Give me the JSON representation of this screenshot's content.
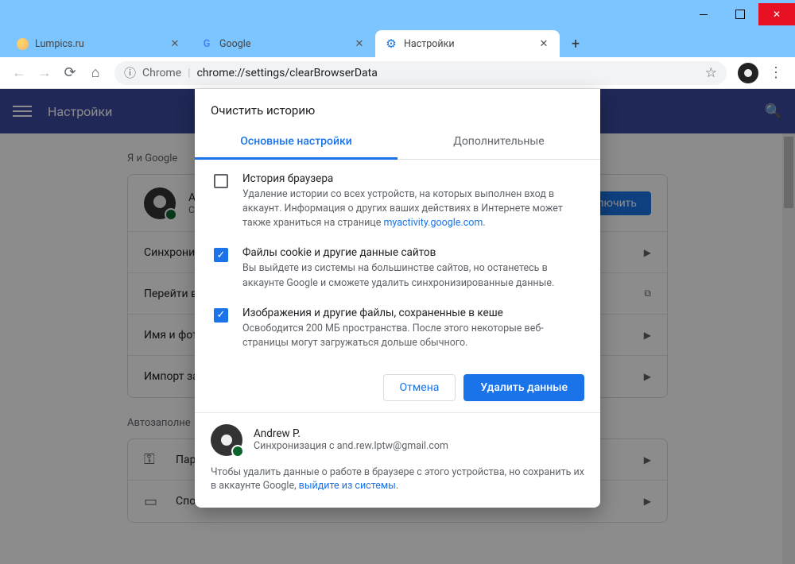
{
  "window": {
    "tabs": [
      {
        "title": "Lumpics.ru"
      },
      {
        "title": "Google"
      },
      {
        "title": "Настройки"
      }
    ]
  },
  "toolbar": {
    "chrome_label": "Chrome",
    "url": "chrome://settings/clearBrowserData"
  },
  "settings": {
    "header_title": "Настройки",
    "section_me_google": "Я и Google",
    "profile_name_partial": "A",
    "profile_sub_partial": "С",
    "connect_btn": "лючить",
    "row_sync": "Синхрониз",
    "row_goto": "Перейти в",
    "row_name_photo": "Имя и фот",
    "row_import": "Импорт за",
    "section_autofill": "Автозаполне",
    "row_passwords": "Пар",
    "row_payments": "Спо"
  },
  "dialog": {
    "title": "Очистить историю",
    "tab_basic": "Основные настройки",
    "tab_advanced": "Дополнительные",
    "items": [
      {
        "checked": false,
        "title": "История браузера",
        "desc_before": "Удаление истории со всех устройств, на которых выполнен вход в аккаунт. Информация о других ваших действиях в Интернете может также храниться на странице ",
        "link": "myactivity.google.com",
        "desc_after": "."
      },
      {
        "checked": true,
        "title": "Файлы cookie и другие данные сайтов",
        "desc_before": "Вы выйдете из системы на большинстве сайтов, но останетесь в аккаунте Google и сможете удалить синхронизированные данные.",
        "link": "",
        "desc_after": ""
      },
      {
        "checked": true,
        "title": "Изображения и другие файлы, сохраненные в кеше",
        "desc_before": "Освободится 200 МБ пространства. После этого некоторые веб-страницы могут загружаться дольше обычного.",
        "link": "",
        "desc_after": ""
      }
    ],
    "cancel": "Отмена",
    "confirm": "Удалить данные",
    "footer_name": "Andrew P.",
    "footer_sync_prefix": "Синхронизация с ",
    "footer_email": "and.rew.lptw@gmail.com",
    "footer_note_before": "Чтобы удалить данные о работе в браузере с этого устройства, но сохранить их в аккаунте Google, ",
    "footer_note_link": "выйдите из системы",
    "footer_note_after": "."
  }
}
